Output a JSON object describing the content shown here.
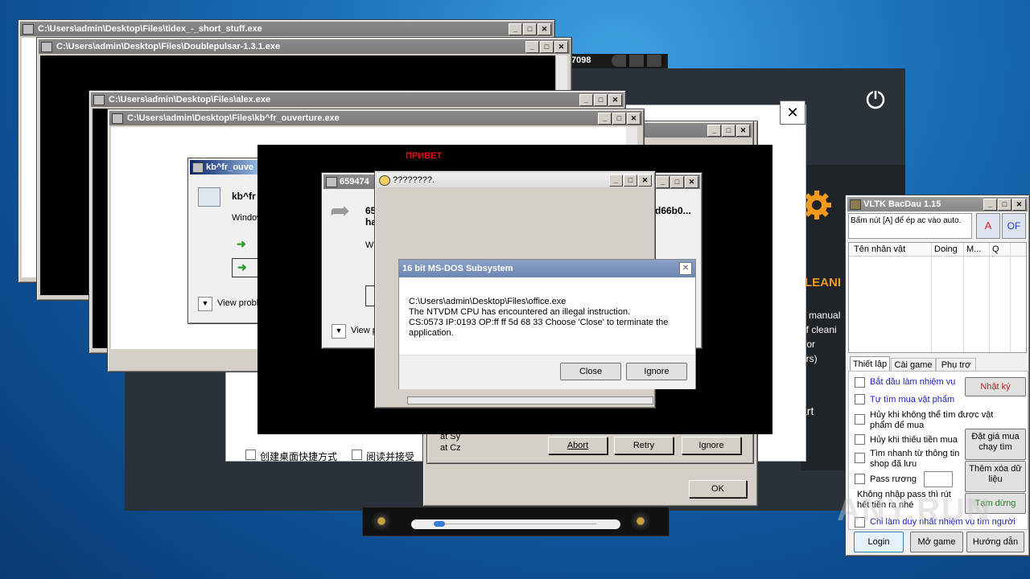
{
  "windows": {
    "tidex": {
      "title": "C:\\Users\\admin\\Desktop\\Files\\tidex_-_short_stuff.exe"
    },
    "doublepulsar": {
      "title": "C:\\Users\\admin\\Desktop\\Files\\Doublepulsar-1.3.1.exe"
    },
    "alex": {
      "title": "C:\\Users\\admin\\Desktop\\Files\\alex.exe"
    },
    "kbfr": {
      "title": "C:\\Users\\admin\\Desktop\\Files\\kb^fr_ouverture.exe"
    },
    "kbfr_dialog": {
      "title": "kb^fr_ouve",
      "heading": "kb^fr",
      "body": "Window",
      "view_problem": "View probl"
    },
    "dlg659": {
      "title": "659474",
      "heading1": "65",
      "heading2": "ha",
      "body": "Wi",
      "hash_tail": "d66b0...",
      "view_problem": "View p"
    },
    "qmarks": {
      "title": "????????."
    },
    "ntvdm": {
      "title": "16 bit MS-DOS Subsystem",
      "path": "C:\\Users\\admin\\Desktop\\Files\\office.exe",
      "line1": "The NTVDM CPU has encountered an illegal instruction.",
      "line2": "CS:0573 IP:0193 OP:ff ff 5d 68 33 Choose 'Close' to terminate the",
      "line3": "application.",
      "close_label": "Close",
      "ignore_label": "Ignore"
    },
    "media": {
      "title_fragment": "7098"
    },
    "black_console": {
      "red_text": "ПРИВЕТ"
    },
    "error_box": {
      "at_line1": "at Sy",
      "at_line2": "at Cz",
      "abort_label": "Abort",
      "retry_label": "Retry",
      "ignore_label": "Ignore",
      "ok_label": "OK"
    },
    "chinese_installer": {
      "chk1": "创建桌面快捷方式",
      "chk2": "阅读并接受"
    },
    "cleaner": {
      "title_fragment": "LEANI",
      "line1": "o manual",
      "line2": "of cleani",
      "line3": "(for",
      "line4": "ers)",
      "start_fragment": "art"
    }
  },
  "vltk": {
    "title": "VLTK BacDau 1.15",
    "info": "Bấm nút [A] để ép ac vào auto.",
    "btn_a": "A",
    "btn_of": "OF",
    "columns": [
      "Tên nhân vật",
      "Doing",
      "M...",
      "Q"
    ],
    "tabs": [
      "Thiết lập",
      "Cài game",
      "Phụ trợ"
    ],
    "checks": [
      "Bắt đầu làm nhiệm vụ",
      "Tự tìm mua vật phẩm",
      "Hủy khi không thể tìm được vật phẩm để mua",
      "Hủy khi thiếu tiền mua",
      "Tìm nhanh từ thông tin shop đã lưu",
      "Pass rương"
    ],
    "note": "Không nhập pass thì rút hết tiền ra nhé",
    "last_check": "Chỉ làm duy nhất nhiệm vụ tìm người",
    "side_buttons": [
      "Nhật ký",
      "Đặt giá mua chạy tìm",
      "Thêm xóa dữ liệu",
      "Tạm dừng"
    ],
    "bottom_buttons": [
      "Login",
      "Mở game",
      "Hướng dẫn"
    ]
  },
  "watermark": "ANY.RUN"
}
